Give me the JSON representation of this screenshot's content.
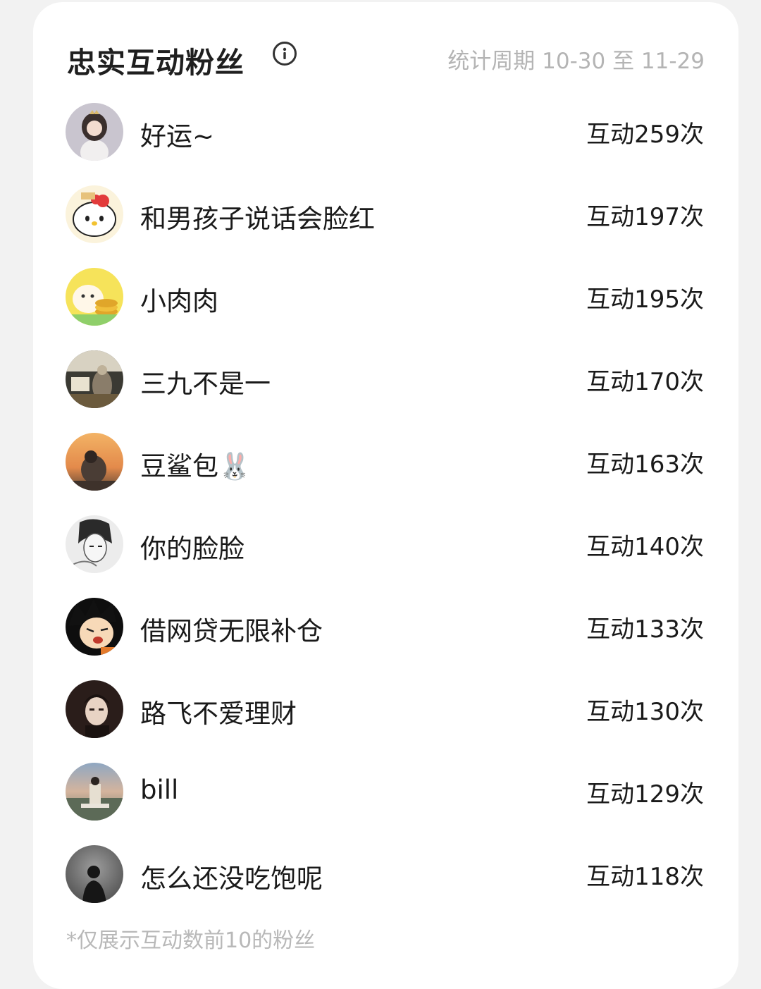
{
  "header": {
    "title": "忠实互动粉丝",
    "info_icon": "info-circle-icon",
    "period": "统计周期 10-30 至 11-29"
  },
  "fans": [
    {
      "name": "好运~",
      "count": "互动259次",
      "avatar": "girl-doll-avatar"
    },
    {
      "name": "和男孩子说话会脸红",
      "count": "互动197次",
      "avatar": "hello-kitty-avatar"
    },
    {
      "name": "小肉肉",
      "count": "互动195次",
      "avatar": "cat-coins-avatar"
    },
    {
      "name": "三九不是一",
      "count": "互动170次",
      "avatar": "dim-photo-avatar"
    },
    {
      "name": "豆鲨包🐰",
      "count": "互动163次",
      "avatar": "sunset-photo-avatar"
    },
    {
      "name": "你的脸脸",
      "count": "互动140次",
      "avatar": "manga-sketch-avatar"
    },
    {
      "name": "借网贷无限补仓",
      "count": "互动133次",
      "avatar": "anime-boy-avatar"
    },
    {
      "name": "路飞不爱理财",
      "count": "互动130次",
      "avatar": "portrait-photo-avatar"
    },
    {
      "name": "bill",
      "count": "互动129次",
      "avatar": "outdoor-person-avatar"
    },
    {
      "name": "怎么还没吃饱呢",
      "count": "互动118次",
      "avatar": "silhouette-avatar"
    }
  ],
  "footnote": "*仅展示互动数前10的粉丝",
  "colors": {
    "background": "#f2f2f2",
    "card": "#ffffff",
    "text": "#1a1a1a",
    "muted": "#b4b4b4"
  }
}
